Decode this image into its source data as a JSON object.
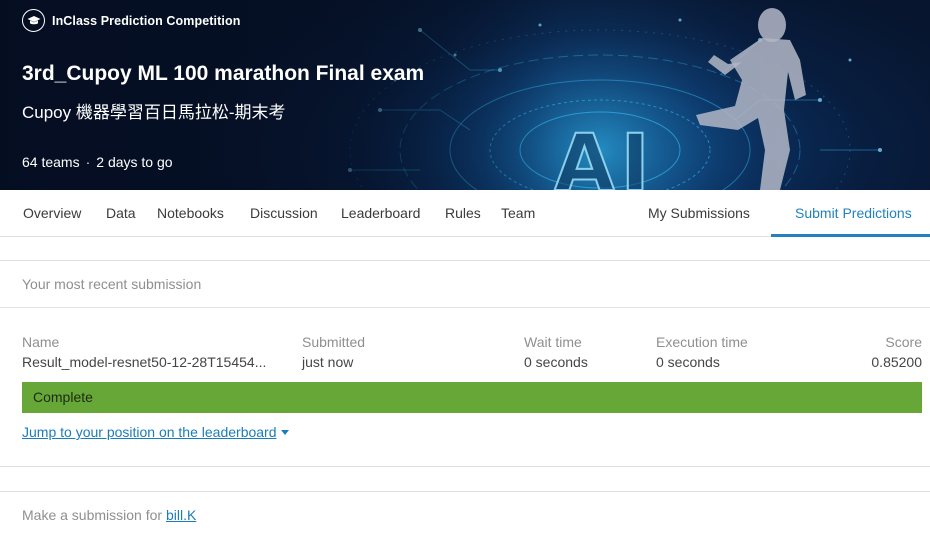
{
  "hero": {
    "badge": "InClass Prediction Competition",
    "title": "3rd_Cupoy ML 100 marathon Final exam",
    "subtitle": "Cupoy 機器學習百日馬拉松-期末考",
    "teams": "64 teams",
    "separator": "·",
    "deadline": "2 days to go",
    "art_text": "AI",
    "colors": {
      "bg_dark": "#07152e",
      "bg_glow": "#0d4e86",
      "circuit": "#38c8ff",
      "figure": "#b7bccb"
    }
  },
  "tabs": {
    "items": [
      {
        "label": "Overview"
      },
      {
        "label": "Data"
      },
      {
        "label": "Notebooks"
      },
      {
        "label": "Discussion"
      },
      {
        "label": "Leaderboard"
      },
      {
        "label": "Rules"
      },
      {
        "label": "Team"
      }
    ],
    "my_submissions": "My Submissions",
    "submit_predictions": "Submit Predictions",
    "active": "Submit Predictions",
    "accent_color": "#2182bd"
  },
  "recent": {
    "header": "Your most recent submission",
    "columns": {
      "name": "Name",
      "submitted": "Submitted",
      "wait_time": "Wait time",
      "execution_time": "Execution time",
      "score": "Score"
    },
    "row": {
      "name": "Result_model-resnet50-12-28T15454...",
      "submitted": "just now",
      "wait_time": "0 seconds",
      "execution_time": "0 seconds",
      "score": "0.85200"
    },
    "status": "Complete",
    "status_color": "#66a737",
    "jump_link": "Jump to your position on the leaderboard"
  },
  "make_submission": {
    "prefix": "Make a submission for",
    "user": "bill.K"
  }
}
